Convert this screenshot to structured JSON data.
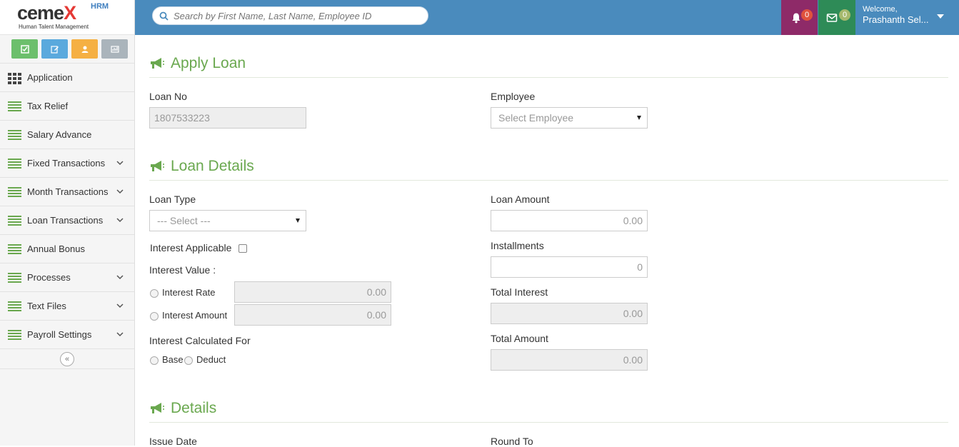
{
  "brand": {
    "name_part1": "ceme",
    "name_part2": "X",
    "tag": "HRM",
    "subtitle": "Human Talent Management"
  },
  "quick_actions": [
    {
      "icon": "check-square-icon",
      "color": "#6cbf6c"
    },
    {
      "icon": "edit-icon",
      "color": "#5aa9dd"
    },
    {
      "icon": "user-icon",
      "color": "#f5b043"
    },
    {
      "icon": "chart-icon",
      "color": "#aab4bb"
    }
  ],
  "sidebar": {
    "items": [
      {
        "label": "Application",
        "icon": "grid-icon",
        "expandable": false
      },
      {
        "label": "Tax Relief",
        "icon": "list-icon",
        "expandable": false
      },
      {
        "label": "Salary Advance",
        "icon": "list-icon",
        "expandable": false
      },
      {
        "label": "Fixed Transactions",
        "icon": "list-icon",
        "expandable": true
      },
      {
        "label": "Month Transactions",
        "icon": "list-icon",
        "expandable": true
      },
      {
        "label": "Loan Transactions",
        "icon": "list-icon",
        "expandable": true
      },
      {
        "label": "Annual Bonus",
        "icon": "list-icon",
        "expandable": false
      },
      {
        "label": "Processes",
        "icon": "list-icon",
        "expandable": true
      },
      {
        "label": "Text Files",
        "icon": "list-icon",
        "expandable": true
      },
      {
        "label": "Payroll Settings",
        "icon": "list-icon",
        "expandable": true
      }
    ],
    "collapse_symbol": "«"
  },
  "topbar": {
    "search_placeholder": "Search by First Name, Last Name, Employee ID",
    "notifications_count": "0",
    "messages_count": "0",
    "welcome": "Welcome,",
    "user_name": "Prashanth Sel..."
  },
  "colors": {
    "accent": "#6aa84f",
    "topbar": "#4a8bbd",
    "notif_bg": "#8e2a68",
    "msg_bg": "#2e8b57"
  },
  "apply_loan": {
    "title": "Apply Loan",
    "loan_no_label": "Loan No",
    "loan_no_value": "1807533223",
    "employee_label": "Employee",
    "employee_placeholder": "Select Employee"
  },
  "loan_details": {
    "title": "Loan Details",
    "loan_type_label": "Loan Type",
    "loan_type_value": "--- Select ---",
    "loan_amount_label": "Loan Amount",
    "loan_amount_value": "0.00",
    "interest_applicable_label": "Interest Applicable",
    "installments_label": "Installments",
    "installments_value": "0",
    "interest_value_label": "Interest Value :",
    "interest_rate_label": "Interest Rate",
    "interest_rate_value": "0.00",
    "interest_amount_label": "Interest Amount",
    "interest_amount_value": "0.00",
    "total_interest_label": "Total Interest",
    "total_interest_value": "0.00",
    "interest_calc_label": "Interest Calculated For",
    "base_label": "Base",
    "deduct_label": "Deduct",
    "total_amount_label": "Total Amount",
    "total_amount_value": "0.00"
  },
  "details": {
    "title": "Details",
    "issue_date_label": "Issue Date",
    "round_to_label": "Round To"
  }
}
